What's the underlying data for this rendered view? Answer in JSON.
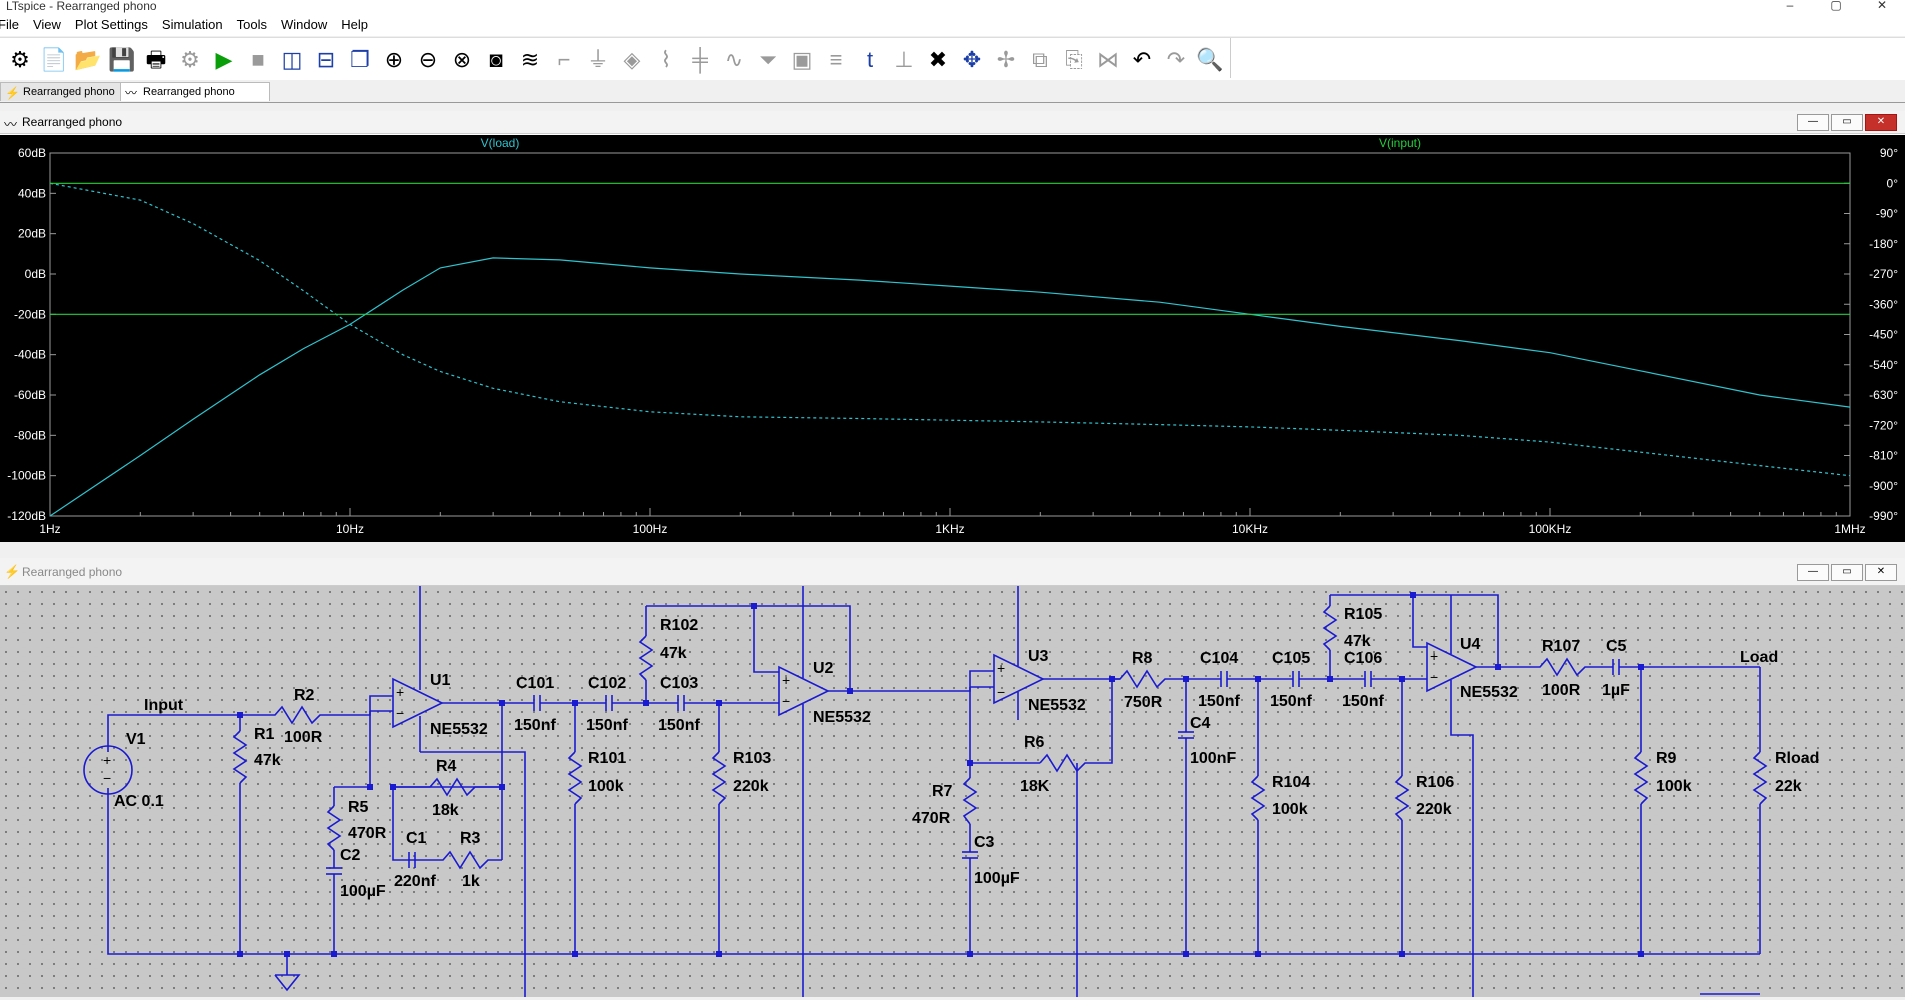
{
  "window": {
    "title": "LTspice - Rearranged phono",
    "min": "–",
    "max": "▢",
    "close": "✕"
  },
  "menu": [
    "File",
    "View",
    "Plot Settings",
    "Simulation",
    "Tools",
    "Window",
    "Help"
  ],
  "toolbar_icons": [
    "settings-icon",
    "open-schematic-icon",
    "open-file-icon",
    "save-icon",
    "print-icon",
    "gear-grey-icon",
    "run-icon",
    "halt-icon",
    "tile-vertical-icon",
    "tile-horizontal-icon",
    "cascade-icon",
    "zoom-in-icon",
    "zoom-out-icon",
    "zoom-fit-icon",
    "autorange-icon",
    "waveform-icon",
    "wire-icon",
    "ground-icon",
    "label-icon",
    "resistor-icon",
    "capacitor-icon",
    "inductor-icon",
    "diode-icon",
    "component-icon",
    "net-icon",
    "text-icon",
    "spice-directive-icon",
    "delete-icon",
    "move-icon",
    "drag-icon",
    "copy-icon",
    "paste-icon",
    "mirror-icon",
    "undo-icon",
    "redo-icon",
    "find-icon"
  ],
  "tabs": [
    {
      "label": "Rearranged phono",
      "icon": "schematic-icon"
    },
    {
      "label": "Rearranged phono",
      "icon": "waveform-icon"
    }
  ],
  "plot_window": {
    "title": "Rearranged phono"
  },
  "schematic_window": {
    "title": "Rearranged phono"
  },
  "chart_data": {
    "type": "line",
    "title": "",
    "x_scale": "log",
    "x_range": [
      1,
      1000000
    ],
    "x_ticks": [
      "1Hz",
      "10Hz",
      "100Hz",
      "1KHz",
      "10KHz",
      "100KHz",
      "1MHz"
    ],
    "y_left_range": [
      -120,
      60
    ],
    "y_left_ticks": [
      "60dB",
      "40dB",
      "20dB",
      "0dB",
      "-20dB",
      "-40dB",
      "-60dB",
      "-80dB",
      "-100dB",
      "-120dB"
    ],
    "y_right_range": [
      -990,
      90
    ],
    "y_right_ticks": [
      "90°",
      "0°",
      "-90°",
      "-180°",
      "-270°",
      "-360°",
      "-450°",
      "-540°",
      "-630°",
      "-720°",
      "-810°",
      "-900°",
      "-990°"
    ],
    "series": [
      {
        "name": "V(load)",
        "color": "#2ec4cf",
        "style": "solid",
        "axis": "magnitude",
        "x": [
          1,
          2,
          3,
          5,
          7,
          10,
          15,
          20,
          30,
          50,
          100,
          200,
          500,
          1000,
          2000,
          5000,
          10000,
          20000,
          50000,
          100000,
          200000,
          500000,
          1000000
        ],
        "y": [
          -120,
          -90,
          -72,
          -50,
          -37,
          -25,
          -8,
          3,
          8,
          7,
          3,
          0,
          -3,
          -6,
          -9,
          -14,
          -20,
          -26,
          -33,
          -39,
          -48,
          -60,
          -66
        ]
      },
      {
        "name": "",
        "color": "#2ec4cf",
        "style": "dashed",
        "axis": "phase",
        "x": [
          1,
          2,
          3,
          5,
          7,
          10,
          15,
          20,
          30,
          50,
          100,
          200,
          500,
          1000,
          2000,
          5000,
          10000,
          20000,
          50000,
          100000,
          200000,
          500000,
          1000000
        ],
        "y": [
          0,
          -50,
          -120,
          -230,
          -320,
          -420,
          -510,
          -560,
          -610,
          -650,
          -680,
          -695,
          -700,
          -705,
          -710,
          -718,
          -725,
          -735,
          -750,
          -770,
          -800,
          -840,
          -870
        ]
      },
      {
        "name": "V(input)",
        "color": "#23cf3c",
        "style": "solid",
        "axis": "magnitude",
        "x": [
          1,
          1000000
        ],
        "y": [
          -20,
          -20
        ]
      },
      {
        "name": "",
        "color": "#23cf3c",
        "style": "solid",
        "axis": "phase",
        "x": [
          1,
          1000000
        ],
        "y": [
          0,
          0
        ]
      }
    ]
  },
  "schematic": {
    "labels": {
      "input": "Input",
      "load": "Load",
      "v1": "V1",
      "v1_val": "AC 0.1",
      "r1": "R1",
      "r1_val": "47k",
      "r2": "R2",
      "r2_val": "100R",
      "u1": "U1",
      "u1_val": "NE5532",
      "r4": "R4",
      "r4_val": "18k",
      "r5": "R5",
      "r5_val": "470R",
      "c2": "C2",
      "c2_val": "100µF",
      "c1": "C1",
      "c1_val": "220nf",
      "r3": "R3",
      "r3_val": "1k",
      "c101": "C101",
      "c101_val": "150nf",
      "c102": "C102",
      "c102_val": "150nf",
      "r102": "R102",
      "r102_val": "47k",
      "c103": "C103",
      "c103_val": "150nf",
      "r101": "R101",
      "r101_val": "100k",
      "r103": "R103",
      "r103_val": "220k",
      "u2": "U2",
      "u2_val": "NE5532",
      "u3": "U3",
      "u3_val": "NE5532",
      "r6": "R6",
      "r6_val": "18K",
      "r7": "R7",
      "r7_val": "470R",
      "c3": "C3",
      "c3_val": "100µF",
      "r8": "R8",
      "r8_val": "750R",
      "c4": "C4",
      "c4_val": "100nF",
      "c104": "C104",
      "c104_val": "150nf",
      "c105": "C105",
      "c105_val": "150nf",
      "c106": "C106",
      "c106_val": "150nf",
      "r105": "R105",
      "r105_val": "47k",
      "r104": "R104",
      "r104_val": "100k",
      "r106": "R106",
      "r106_val": "220k",
      "u4": "U4",
      "u4_val": "NE5532",
      "r107": "R107",
      "r107_val": "100R",
      "c5": "C5",
      "c5_val": "1µF",
      "r9": "R9",
      "r9_val": "100k",
      "rload": "Rload",
      "rload_val": "22k"
    }
  }
}
